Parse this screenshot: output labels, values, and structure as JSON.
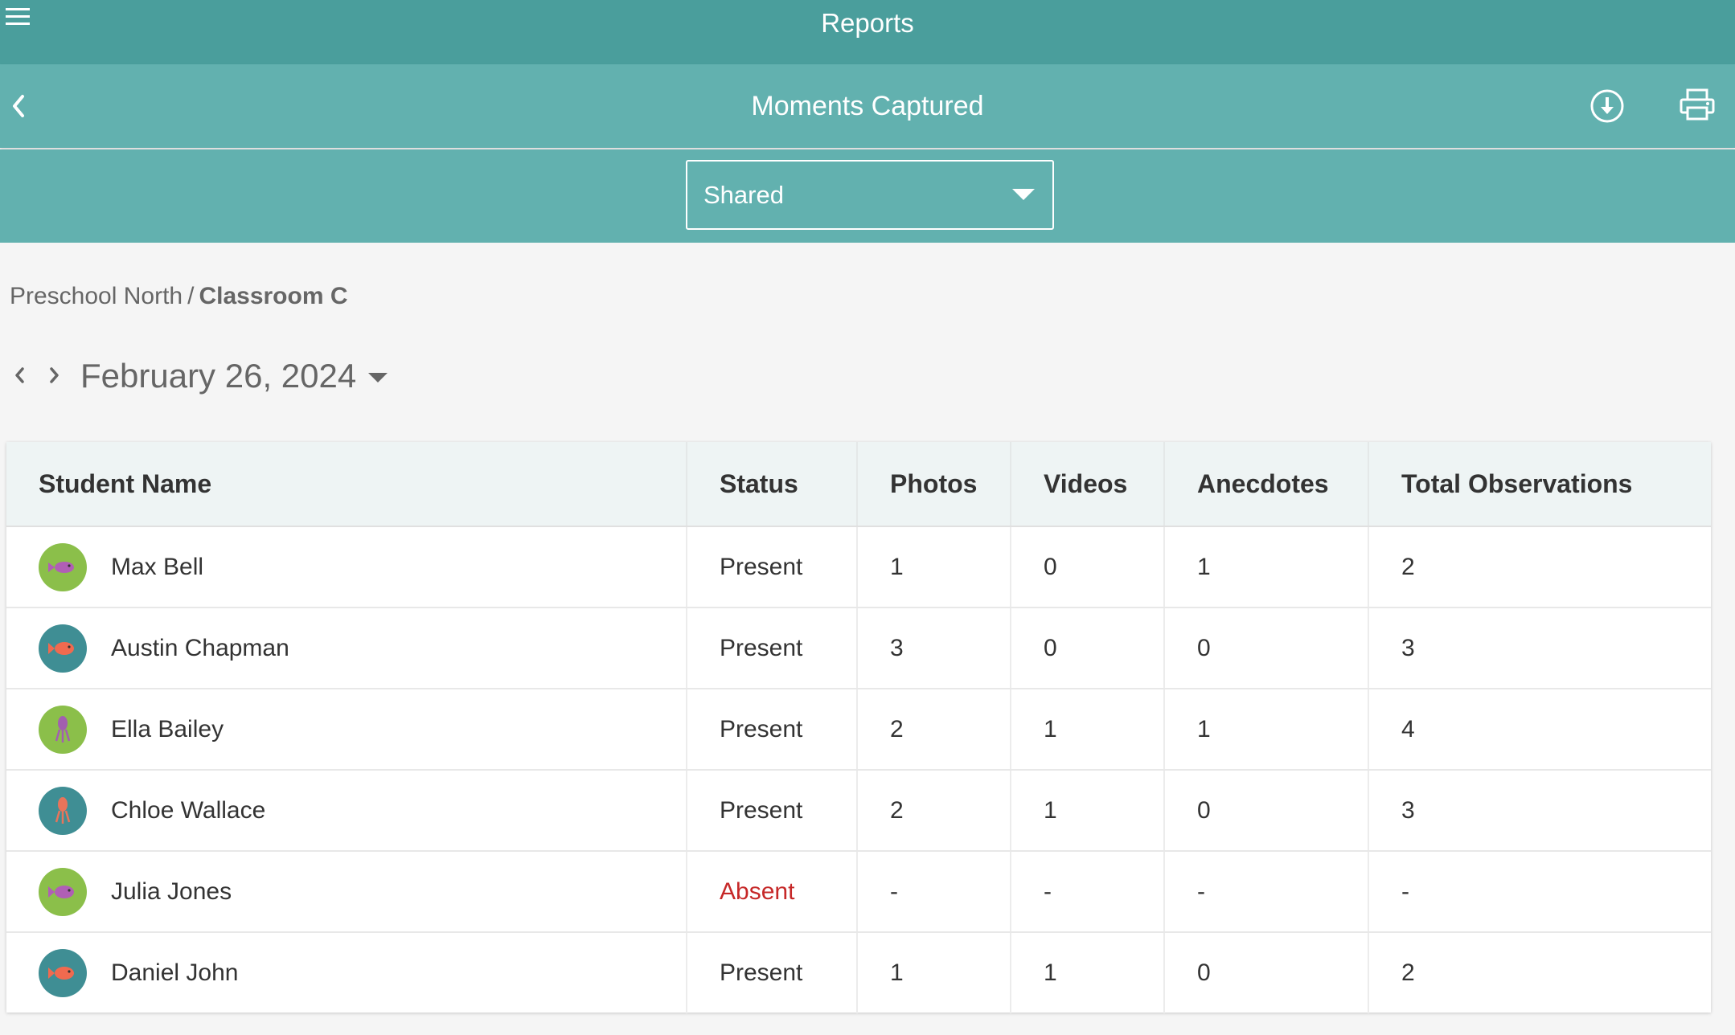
{
  "app_bar": {
    "title": "Reports"
  },
  "sub_bar": {
    "title": "Moments Captured"
  },
  "filter": {
    "selected": "Shared"
  },
  "breadcrumb": {
    "parent": "Preschool North",
    "separator": "/",
    "current": "Classroom C"
  },
  "date_nav": {
    "date": "February 26, 2024"
  },
  "table": {
    "headers": [
      "Student Name",
      "Status",
      "Photos",
      "Videos",
      "Anecdotes",
      "Total Observations"
    ],
    "rows": [
      {
        "name": "Max Bell",
        "avatar": "fish-avatar-green",
        "status": "Present",
        "photos": "1",
        "videos": "0",
        "anecdotes": "1",
        "total": "2"
      },
      {
        "name": "Austin Chapman",
        "avatar": "fish-avatar-teal",
        "status": "Present",
        "photos": "3",
        "videos": "0",
        "anecdotes": "0",
        "total": "3"
      },
      {
        "name": "Ella Bailey",
        "avatar": "squid-avatar-green",
        "status": "Present",
        "photos": "2",
        "videos": "1",
        "anecdotes": "1",
        "total": "4"
      },
      {
        "name": "Chloe Wallace",
        "avatar": "squid-avatar-teal",
        "status": "Present",
        "photos": "2",
        "videos": "1",
        "anecdotes": "0",
        "total": "3"
      },
      {
        "name": "Julia Jones",
        "avatar": "fish-avatar-green",
        "status": "Absent",
        "photos": "-",
        "videos": "-",
        "anecdotes": "-",
        "total": "-"
      },
      {
        "name": "Daniel John",
        "avatar": "fish-avatar-teal",
        "status": "Present",
        "photos": "1",
        "videos": "1",
        "anecdotes": "0",
        "total": "2"
      }
    ]
  },
  "colors": {
    "app_bar": "#4a9e9c",
    "sub_bar": "#62b1af",
    "absent": "#c62828",
    "avatar_green": "#8bbf4a",
    "avatar_teal": "#3f8e94"
  },
  "icons": {
    "menu": "hamburger-menu-icon",
    "back": "chevron-left-icon",
    "download": "download-circle-icon",
    "print": "printer-icon",
    "dropdown": "caret-down-icon",
    "prev": "chevron-left-icon",
    "next": "chevron-right-icon"
  }
}
